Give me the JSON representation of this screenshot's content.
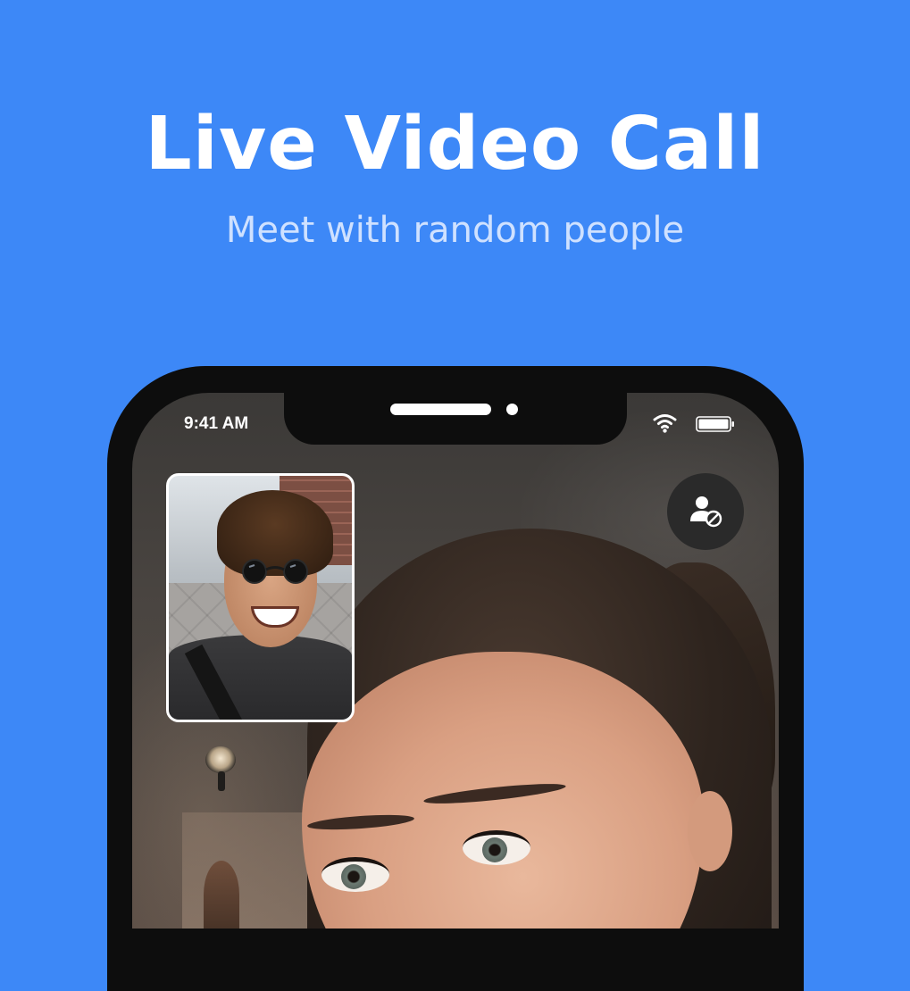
{
  "promo": {
    "title": "Live Video Call",
    "subtitle": "Meet with random people"
  },
  "status_bar": {
    "time": "9:41 AM",
    "wifi_icon": "wifi-icon",
    "battery_icon": "battery-icon"
  },
  "call": {
    "self_preview_icon": "self-video-preview",
    "block_user_icon": "block-user-icon"
  },
  "colors": {
    "background": "#3d88f7",
    "phone_frame": "#0d0d0d",
    "subtitle": "#cfe1ff",
    "button": "#2a2a2a"
  }
}
